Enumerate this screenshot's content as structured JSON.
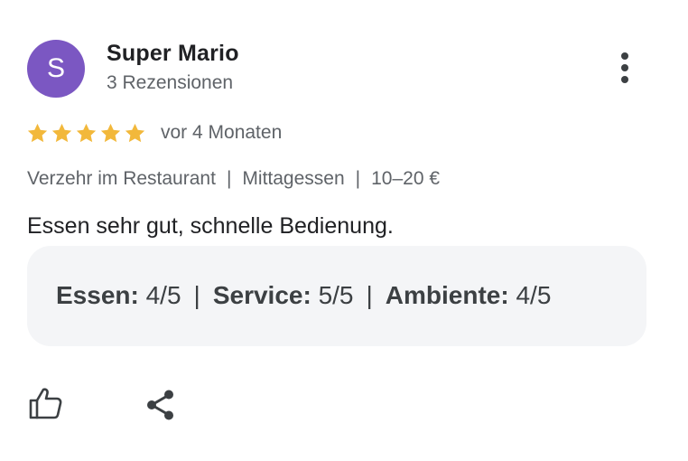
{
  "reviewer": {
    "avatar_letter": "S",
    "avatar_color": "#7b57c2",
    "name": "Super Mario",
    "review_count": "3 Rezensionen"
  },
  "rating": {
    "stars": 5,
    "max_stars": 5,
    "star_color": "#f2b83b",
    "time_ago": "vor 4 Monaten"
  },
  "meta": {
    "service_type": "Verzehr im Restaurant",
    "meal_type": "Mittagessen",
    "price_range": "10–20 €",
    "separator": "|"
  },
  "review": {
    "text": "Essen sehr gut, schnelle Bedienung."
  },
  "sub_ratings": [
    {
      "label": "Essen:",
      "value": "4/5"
    },
    {
      "label": "Service:",
      "value": "5/5"
    },
    {
      "label": "Ambiente:",
      "value": "4/5"
    }
  ],
  "actions": {
    "like_icon": "thumbs-up-icon",
    "share_icon": "share-icon",
    "more_icon": "more-vert-icon"
  }
}
